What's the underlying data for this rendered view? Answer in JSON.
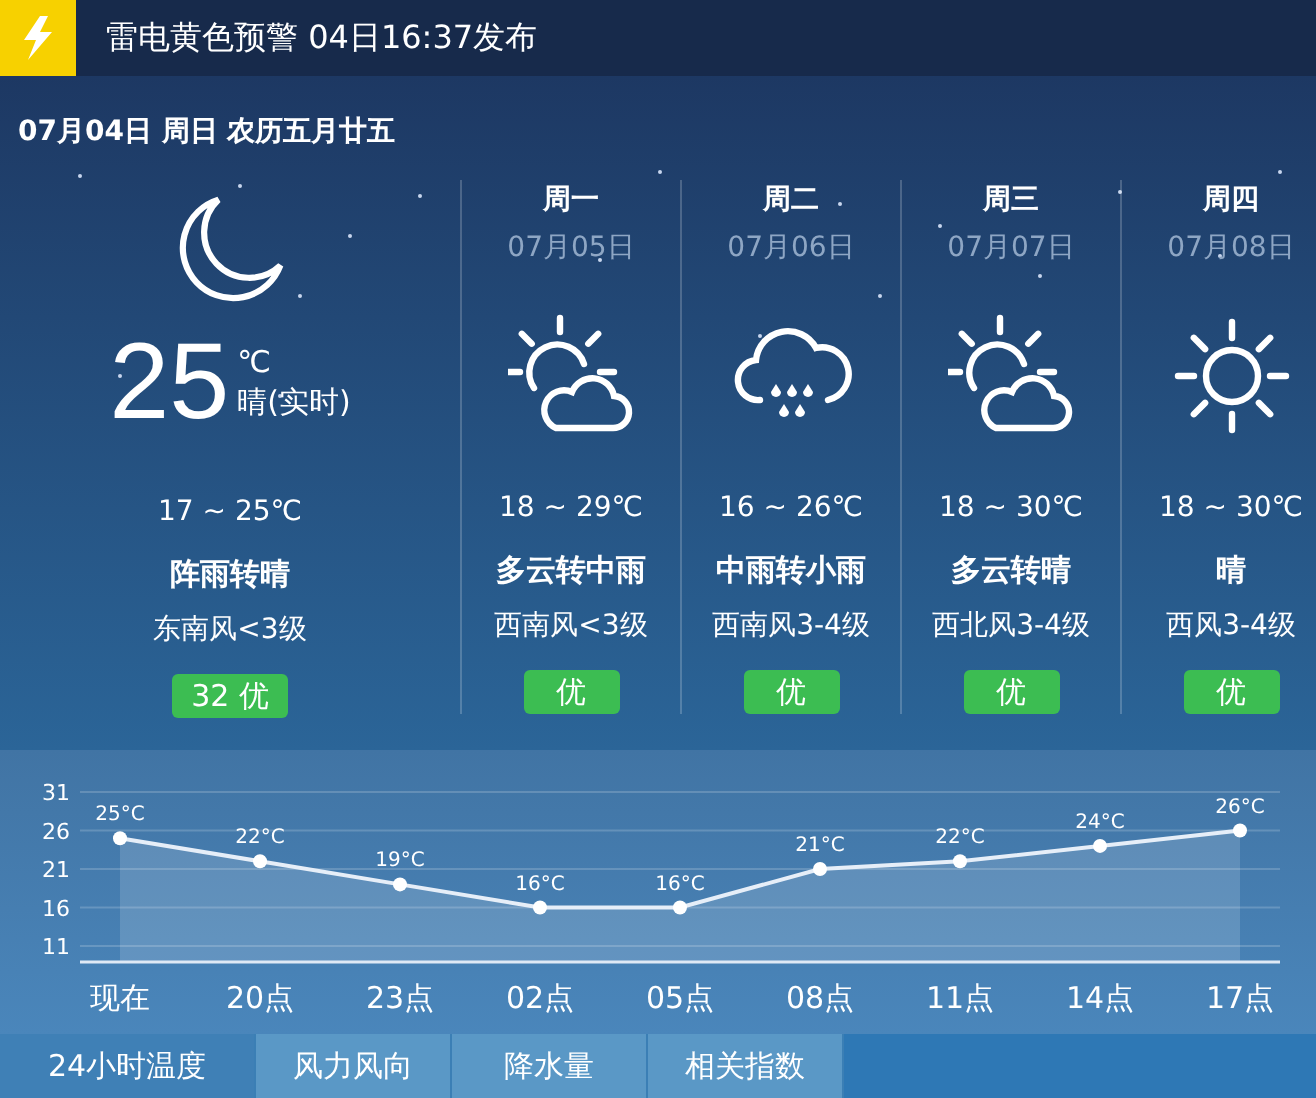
{
  "alert": {
    "kind": "thunder",
    "text": "雷电黄色预警 04日16:37发布"
  },
  "date_line": "07月04日 周日 农历五月廿五",
  "current": {
    "kind": "moon",
    "temperature": "25",
    "unit": "℃",
    "condition": "晴(实时)",
    "range": "17 ~ 25℃",
    "forecast": "阵雨转晴",
    "wind": "东南风<3级",
    "aqi": "32 优"
  },
  "days": [
    {
      "weekday": "周一",
      "date": "07月05日",
      "kind": "partly-cloudy",
      "range": "18 ~ 29℃",
      "condition": "多云转中雨",
      "wind": "西南风<3级",
      "aqi": "优"
    },
    {
      "weekday": "周二",
      "date": "07月06日",
      "kind": "rain",
      "range": "16 ~ 26℃",
      "condition": "中雨转小雨",
      "wind": "西南风3-4级",
      "aqi": "优"
    },
    {
      "weekday": "周三",
      "date": "07月07日",
      "kind": "partly-cloudy",
      "range": "18 ~ 30℃",
      "condition": "多云转晴",
      "wind": "西北风3-4级",
      "aqi": "优"
    },
    {
      "weekday": "周四",
      "date": "07月08日",
      "kind": "sun",
      "range": "18 ~ 30℃",
      "condition": "晴",
      "wind": "西风3-4级",
      "aqi": "优"
    }
  ],
  "chart": {
    "chart_data": {
      "type": "area",
      "categories": [
        "现在",
        "20点",
        "23点",
        "02点",
        "05点",
        "08点",
        "11点",
        "14点",
        "17点"
      ],
      "values": [
        25,
        22,
        19,
        16,
        16,
        21,
        22,
        24,
        26
      ],
      "value_labels": [
        "25°C",
        "22°C",
        "19°C",
        "16°C",
        "16°C",
        "21°C",
        "22°C",
        "24°C",
        "26°C"
      ],
      "yticks": [
        11,
        16,
        21,
        26,
        31
      ],
      "ylim": [
        11,
        31
      ],
      "grid": true
    }
  },
  "tabs": [
    {
      "label": "24小时温度",
      "selected": true
    },
    {
      "label": "风力风向",
      "selected": false
    },
    {
      "label": "降水量",
      "selected": false
    },
    {
      "label": "相关指数",
      "selected": false
    }
  ]
}
